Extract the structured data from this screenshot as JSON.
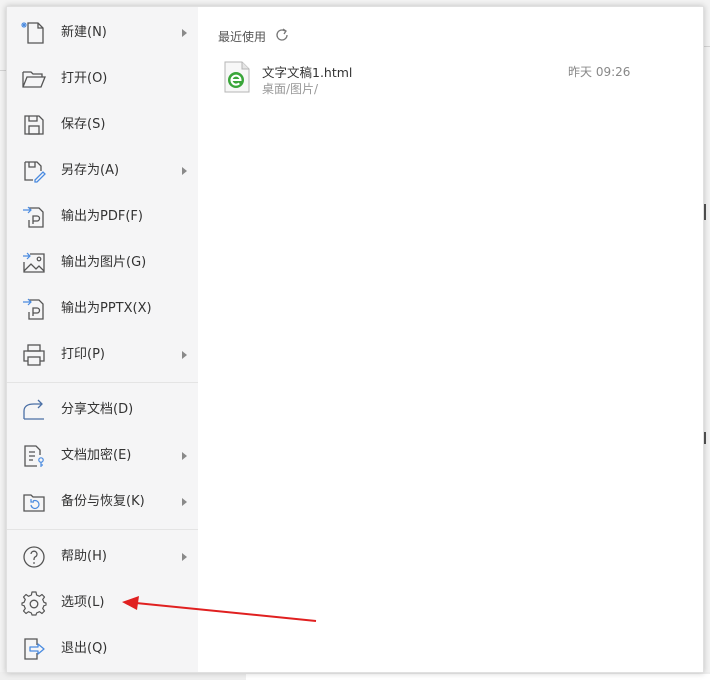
{
  "menu": {
    "items": [
      {
        "label": "新建(N)",
        "icon": "new-file-icon",
        "has_submenu": true
      },
      {
        "label": "打开(O)",
        "icon": "folder-open-icon",
        "has_submenu": false
      },
      {
        "label": "保存(S)",
        "icon": "save-icon",
        "has_submenu": false
      },
      {
        "label": "另存为(A)",
        "icon": "save-as-icon",
        "has_submenu": true
      },
      {
        "label": "输出为PDF(F)",
        "icon": "export-pdf-icon",
        "has_submenu": false
      },
      {
        "label": "输出为图片(G)",
        "icon": "export-image-icon",
        "has_submenu": false
      },
      {
        "label": "输出为PPTX(X)",
        "icon": "export-pptx-icon",
        "has_submenu": false
      },
      {
        "label": "打印(P)",
        "icon": "printer-icon",
        "has_submenu": true
      },
      {
        "label": "分享文档(D)",
        "icon": "share-icon",
        "has_submenu": false
      },
      {
        "label": "文档加密(E)",
        "icon": "document-lock-icon",
        "has_submenu": true
      },
      {
        "label": "备份与恢复(K)",
        "icon": "backup-restore-icon",
        "has_submenu": true
      },
      {
        "label": "帮助(H)",
        "icon": "help-icon",
        "has_submenu": true
      },
      {
        "label": "选项(L)",
        "icon": "gear-icon",
        "has_submenu": false
      },
      {
        "label": "退出(Q)",
        "icon": "exit-icon",
        "has_submenu": false
      }
    ]
  },
  "recent": {
    "title": "最近使用",
    "files": [
      {
        "name": "文字文稿1.html",
        "path": "桌面/图片/",
        "time": "昨天 09:26",
        "icon": "html-file-icon"
      }
    ]
  },
  "colors": {
    "panel_bg": "#f5f5f6",
    "text": "#333333",
    "muted": "#999999",
    "annotation_red": "#e02020",
    "html_icon_green": "#3aa63a"
  }
}
